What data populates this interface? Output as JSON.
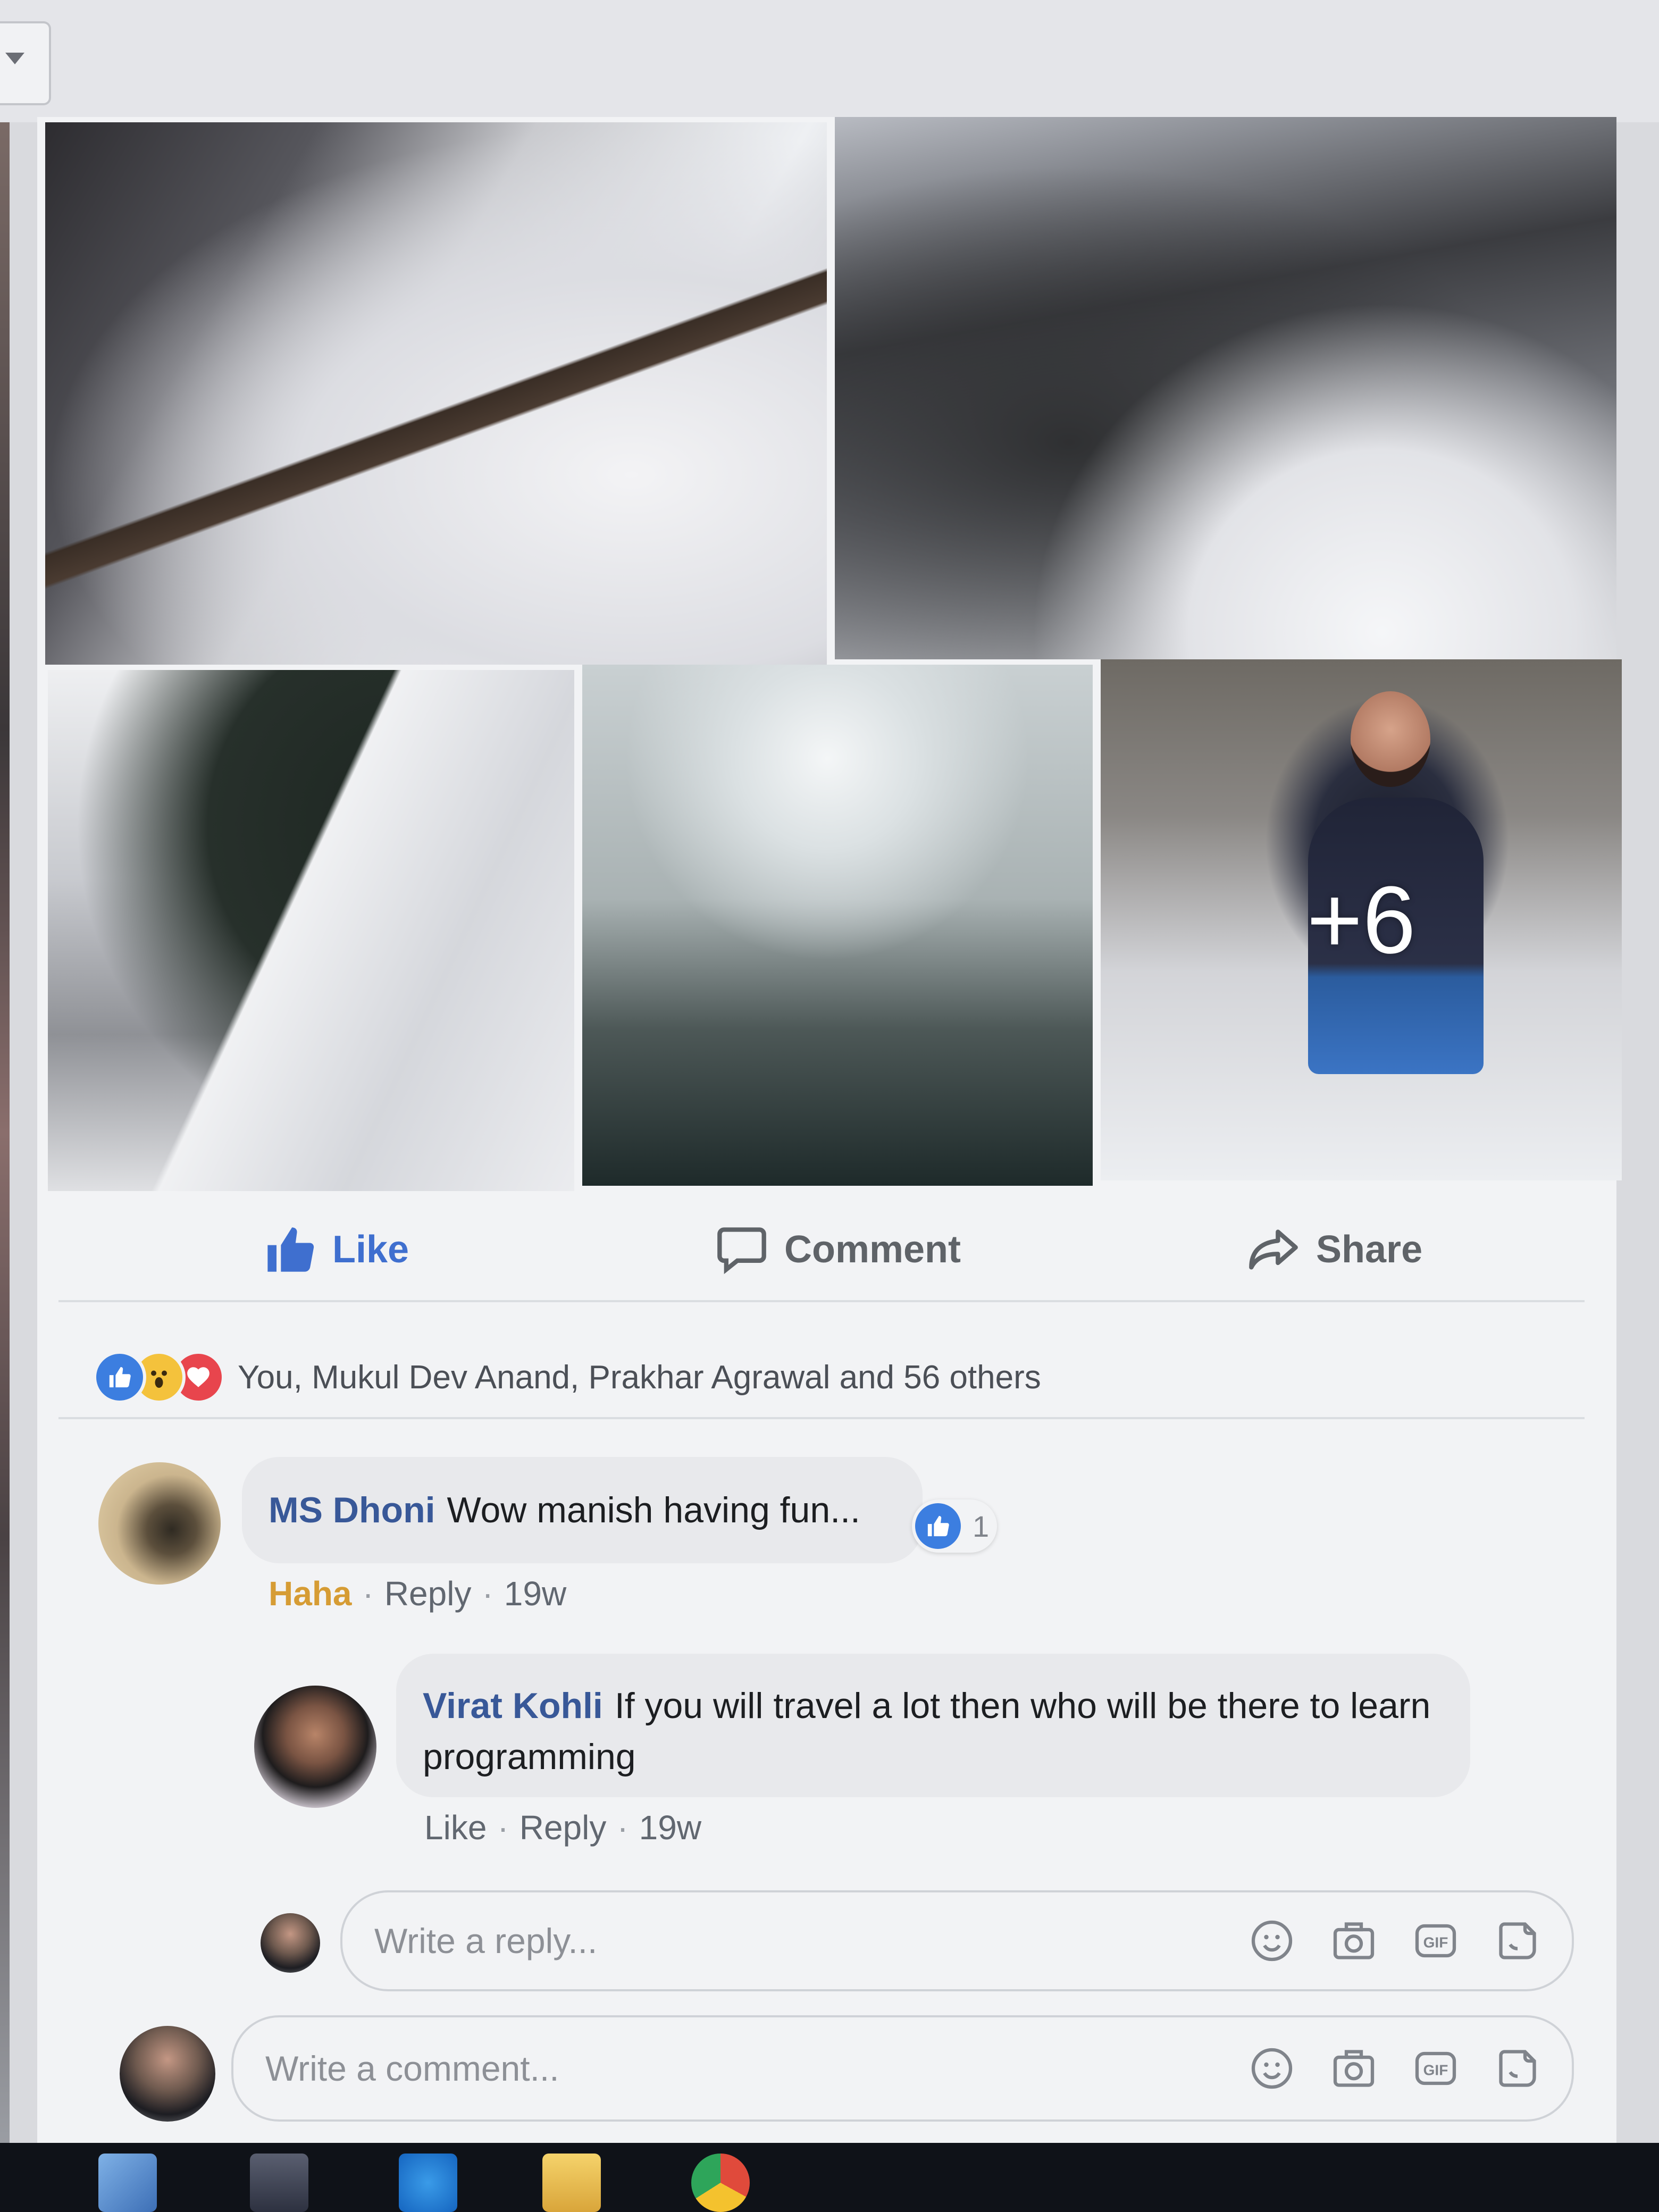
{
  "post": {
    "photos": [
      {
        "name": "snowy-trail-photo"
      },
      {
        "name": "snowy-hillside-photo"
      },
      {
        "name": "snowy-road-photo"
      },
      {
        "name": "foggy-valley-photo"
      },
      {
        "name": "person-in-snow-photo",
        "overlay_text": "+6"
      }
    ],
    "actions": {
      "like_label": "Like",
      "comment_label": "Comment",
      "share_label": "Share"
    },
    "reactions": {
      "icons": [
        "like-reaction-icon",
        "wow-reaction-icon",
        "love-reaction-icon"
      ],
      "summary_text": "You, Mukul Dev Anand, Prakhar Agrawal and 56 others"
    }
  },
  "comments": [
    {
      "author": "MS Dhoni",
      "text": "Wow manish having fun...",
      "like_count": "1",
      "reaction_label": "Haha",
      "reply_label": "Reply",
      "age": "19w"
    },
    {
      "author": "Virat Kohli",
      "text": "If you will travel a lot then who will be there to learn programming",
      "like_label": "Like",
      "reply_label": "Reply",
      "age": "19w"
    }
  ],
  "reply_box": {
    "placeholder": "Write a reply..."
  },
  "comment_box": {
    "placeholder": "Write a comment..."
  },
  "composer_icons": [
    "emoji-icon",
    "camera-icon",
    "gif-icon",
    "sticker-icon"
  ],
  "colors": {
    "accent_blue": "#3f6fcf",
    "author_blue": "#385898",
    "haha_gold": "#d69c34",
    "bubble_gray": "#e8e9ec"
  }
}
